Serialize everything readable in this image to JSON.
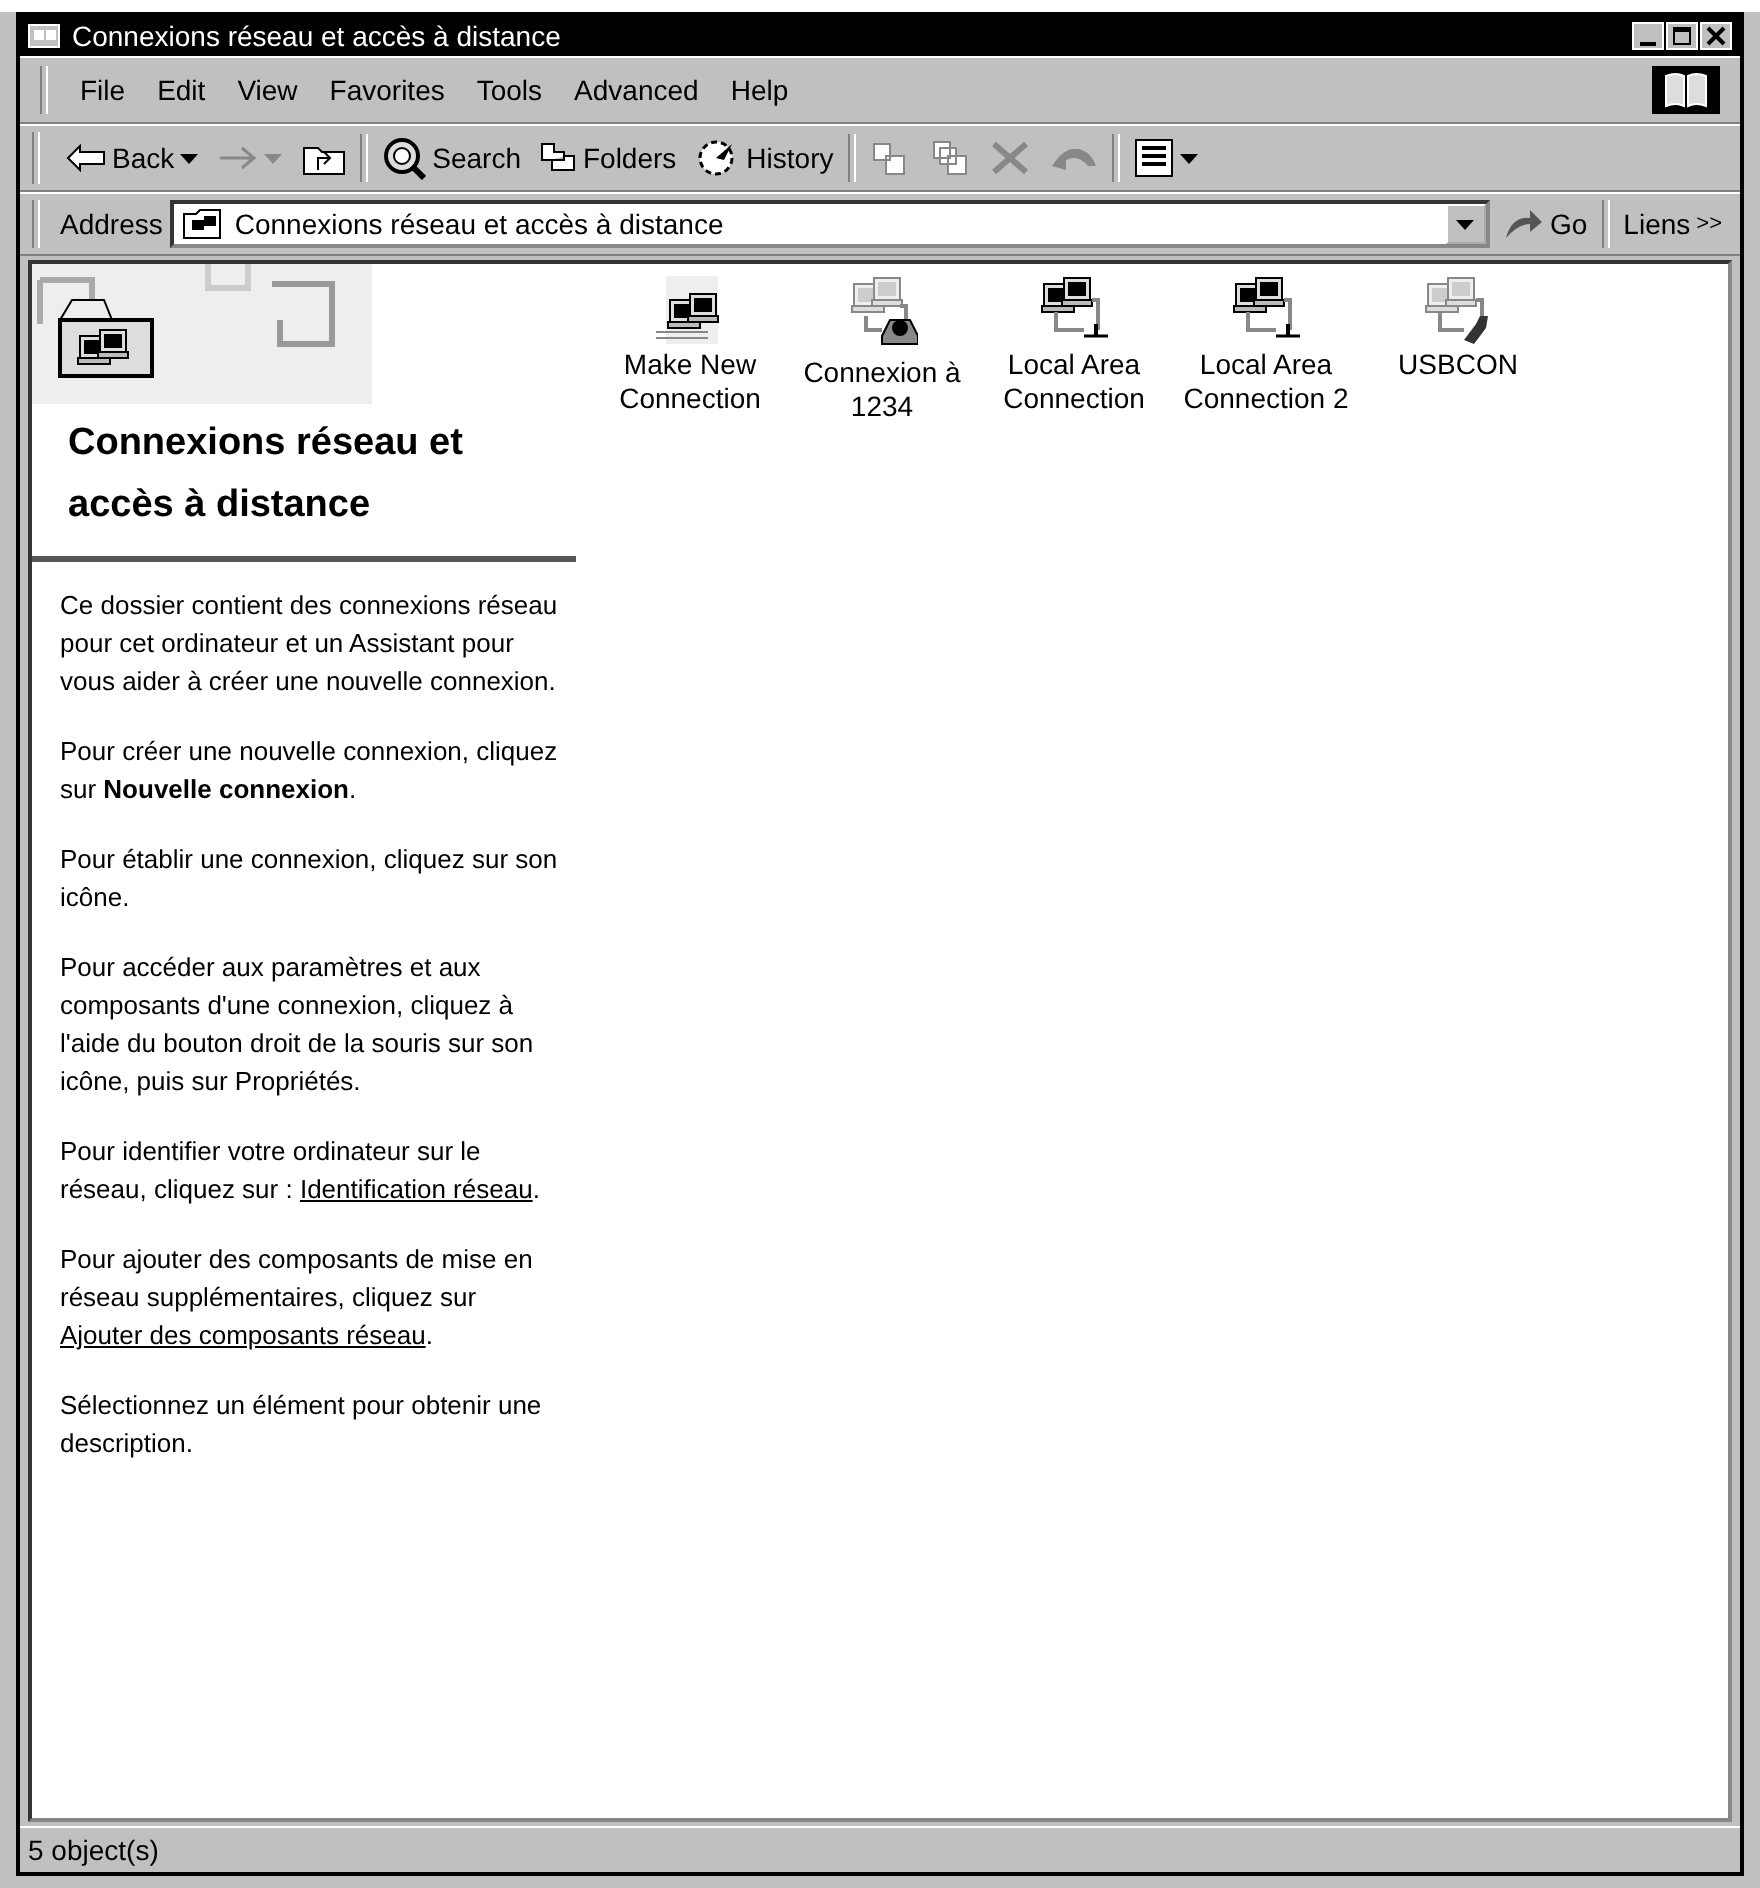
{
  "window": {
    "title": "Connexions réseau et accès à distance"
  },
  "menu": [
    "File",
    "Edit",
    "View",
    "Favorites",
    "Tools",
    "Advanced",
    "Help"
  ],
  "toolbar": [
    {
      "kind": "back",
      "label": "Back",
      "disabled": false
    },
    {
      "kind": "forward",
      "disabled": true
    },
    {
      "kind": "up",
      "disabled": false
    },
    {
      "kind": "search",
      "label": "Search",
      "disabled": false
    },
    {
      "kind": "folders",
      "label": "Folders",
      "disabled": false
    },
    {
      "kind": "history",
      "label": "History",
      "disabled": false
    },
    {
      "kind": "moveto",
      "disabled": true
    },
    {
      "kind": "copyto",
      "disabled": true
    },
    {
      "kind": "delete",
      "disabled": true
    },
    {
      "kind": "undo",
      "disabled": true
    },
    {
      "kind": "views",
      "disabled": false
    }
  ],
  "address": {
    "label": "Address",
    "value": "Connexions réseau et accès à distance",
    "go": "Go",
    "links": "Liens",
    "chevron": ">>"
  },
  "sidebar": {
    "title": "Connexions réseau et accès à distance",
    "paragraphs": [
      [
        {
          "kind": "text",
          "text": "Ce dossier contient des connexions réseau pour cet ordinateur et un Assistant pour vous aider à créer une nouvelle connexion."
        }
      ],
      [
        {
          "kind": "text",
          "text": "Pour créer une nouvelle connexion, cliquez sur **Nouvelle connexion**."
        }
      ],
      [
        {
          "kind": "text",
          "text": "Pour établir une connexion, cliquez sur son icône."
        }
      ],
      [
        {
          "kind": "text",
          "text": "Pour accéder aux paramètres et aux composants d'une connexion, cliquez à l'aide du bouton droit de la souris sur son icône, puis sur Propriétés."
        }
      ],
      [
        {
          "kind": "text",
          "text": "Pour identifier votre ordinateur sur le réseau, cliquez sur : "
        },
        {
          "kind": "link",
          "text": "Identification réseau"
        },
        {
          "kind": "text",
          "text": "."
        }
      ],
      [
        {
          "kind": "text",
          "text": "Pour ajouter des composants de mise en réseau supplémentaires, cliquez sur "
        },
        {
          "kind": "link",
          "text": "Ajouter des composants réseau"
        },
        {
          "kind": "text",
          "text": "."
        }
      ],
      [
        {
          "kind": "text",
          "text": "Sélectionnez un élément pour obtenir une description."
        }
      ]
    ]
  },
  "items": [
    {
      "kind": "new",
      "label": "Make New Connection"
    },
    {
      "kind": "dialup",
      "label": "Connexion à 1234"
    },
    {
      "kind": "lan",
      "label": "Local Area Connection"
    },
    {
      "kind": "lan",
      "label": "Local Area Connection 2"
    },
    {
      "kind": "usb",
      "label": "USBCON"
    }
  ],
  "status_bar": {
    "text": "5 object(s)"
  }
}
